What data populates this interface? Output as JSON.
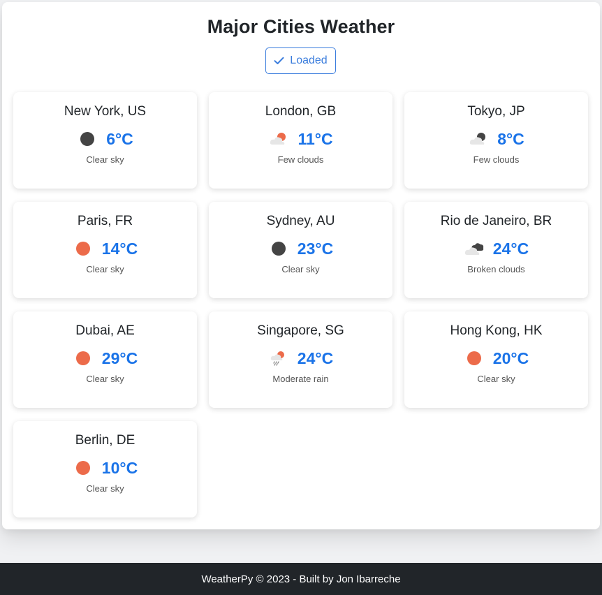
{
  "header": {
    "title": "Major Cities Weather"
  },
  "status": {
    "label": "Loaded",
    "icon": "check-icon",
    "color": "#3b7ddd"
  },
  "accent": {
    "temperature": "#1a73e8",
    "sun": "#ec6b4a",
    "dark": "#444444"
  },
  "cities": [
    {
      "name": "New York, US",
      "temp": "6°C",
      "desc": "Clear sky",
      "icon": "moon-clear-icon"
    },
    {
      "name": "London, GB",
      "temp": "11°C",
      "desc": "Few clouds",
      "icon": "sun-few-clouds-icon"
    },
    {
      "name": "Tokyo, JP",
      "temp": "8°C",
      "desc": "Few clouds",
      "icon": "moon-few-clouds-icon"
    },
    {
      "name": "Paris, FR",
      "temp": "14°C",
      "desc": "Clear sky",
      "icon": "sun-clear-icon"
    },
    {
      "name": "Sydney, AU",
      "temp": "23°C",
      "desc": "Clear sky",
      "icon": "moon-clear-icon"
    },
    {
      "name": "Rio de Janeiro, BR",
      "temp": "24°C",
      "desc": "Broken clouds",
      "icon": "broken-clouds-icon"
    },
    {
      "name": "Dubai, AE",
      "temp": "29°C",
      "desc": "Clear sky",
      "icon": "sun-clear-icon"
    },
    {
      "name": "Singapore, SG",
      "temp": "24°C",
      "desc": "Moderate rain",
      "icon": "rain-icon"
    },
    {
      "name": "Hong Kong, HK",
      "temp": "20°C",
      "desc": "Clear sky",
      "icon": "sun-clear-icon"
    },
    {
      "name": "Berlin, DE",
      "temp": "10°C",
      "desc": "Clear sky",
      "icon": "sun-clear-icon"
    }
  ],
  "footer": {
    "text": "WeatherPy © 2023 - Built by Jon Ibarreche"
  }
}
